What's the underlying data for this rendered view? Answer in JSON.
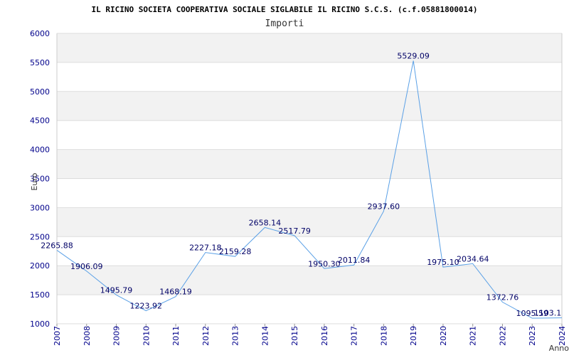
{
  "chart_data": {
    "type": "line",
    "title": "IL RICINO SOCIETA COOPERATIVA SOCIALE SIGLABILE IL RICINO S.C.S. (c.f.05881800014)",
    "subtitle": "Importi",
    "xlabel": "Anno",
    "ylabel": "Euro",
    "ylim": [
      1000,
      6000
    ],
    "yticks": [
      1000,
      1500,
      2000,
      2500,
      3000,
      3500,
      4000,
      4500,
      5000,
      5500,
      6000
    ],
    "x": [
      "2007",
      "2008",
      "2009",
      "2010",
      "2011",
      "2012",
      "2013",
      "2014",
      "2015",
      "2016",
      "2017",
      "2018",
      "2019",
      "2020",
      "2021",
      "2022",
      "2023",
      "2024"
    ],
    "values": [
      2265.88,
      1906.09,
      1495.79,
      1223.92,
      1468.19,
      2227.18,
      2159.28,
      2658.14,
      2517.79,
      1950.3,
      2011.84,
      2937.6,
      5529.09,
      1975.1,
      2034.64,
      1372.76,
      1095.59,
      1103.1
    ],
    "labels": [
      "2265.88",
      "1906.09",
      "1495.79",
      "1223.92",
      "1468.19",
      "2227.18",
      "2159.28",
      "2658.14",
      "2517.79",
      "1950.30",
      "2011.84",
      "2937.60",
      "5529.09",
      "1975.10",
      "2034.64",
      "1372.76",
      "1095.59",
      "1103.1"
    ],
    "grid": true,
    "colors": {
      "line": "#5aa0e6",
      "band": "#f2f2f2",
      "grid": "#dddddd",
      "tick": "#00008b",
      "label": "#000066"
    }
  }
}
